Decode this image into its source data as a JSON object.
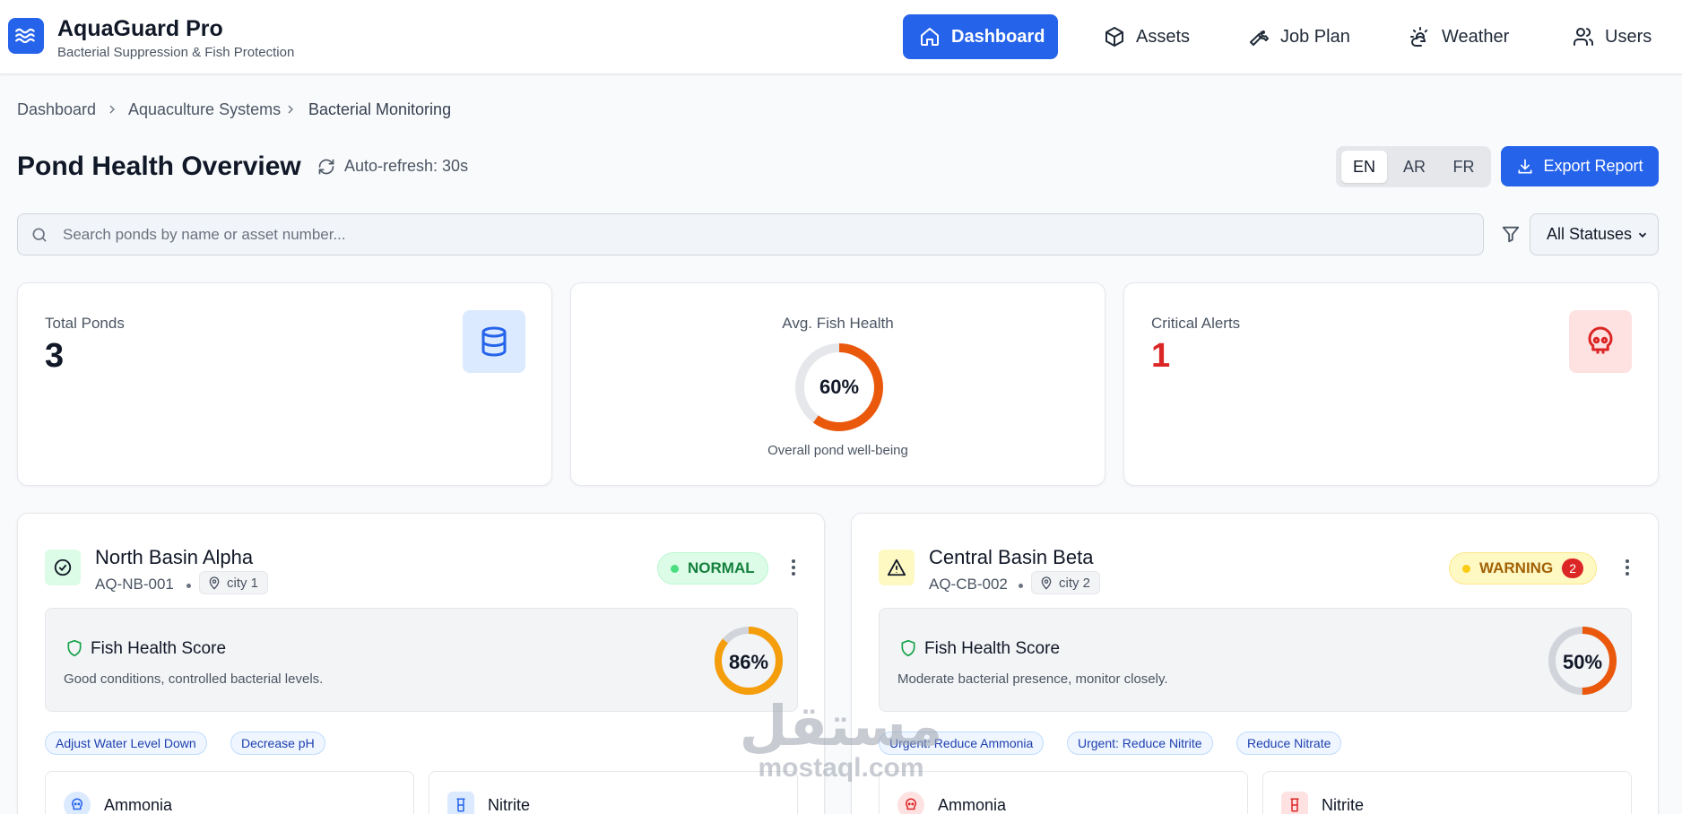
{
  "header": {
    "app_title": "AquaGuard Pro",
    "app_subtitle": "Bacterial Suppression & Fish Protection",
    "nav": [
      {
        "label": "Dashboard",
        "icon": "home-icon",
        "active": true
      },
      {
        "label": "Assets",
        "icon": "box-icon",
        "active": false
      },
      {
        "label": "Job Plan",
        "icon": "wrench-icon",
        "active": false
      },
      {
        "label": "Weather",
        "icon": "sun-cloud-icon",
        "active": false
      },
      {
        "label": "Users",
        "icon": "users-icon",
        "active": false
      }
    ]
  },
  "breadcrumb": [
    "Dashboard",
    "Aquaculture Systems",
    "Bacterial Monitoring"
  ],
  "page": {
    "title": "Pond Health Overview",
    "auto_refresh": "Auto-refresh: 30s",
    "languages": [
      "EN",
      "AR",
      "FR"
    ],
    "active_language": "EN",
    "export_label": "Export Report"
  },
  "search": {
    "placeholder": "Search ponds by name or asset number...",
    "value": "",
    "status_filter": "All Statuses"
  },
  "stats": {
    "total_ponds": {
      "label": "Total Ponds",
      "value": "3",
      "icon": "database-icon"
    },
    "avg_fish_health": {
      "label": "Avg. Fish Health",
      "value": "60%",
      "percent": 60,
      "caption": "Overall pond well-being"
    },
    "critical_alerts": {
      "label": "Critical Alerts",
      "value": "1",
      "icon": "skull-icon"
    }
  },
  "ponds": [
    {
      "name": "North Basin Alpha",
      "asset_id": "AQ-NB-001",
      "city": "city 1",
      "status": "NORMAL",
      "alert_count": "",
      "health_title": "Fish Health Score",
      "health_score": "86%",
      "health_percent": 86,
      "health_desc": "Good conditions, controlled bacterial levels.",
      "tags": [
        "Adjust Water Level Down",
        "Decrease pH"
      ],
      "metrics": [
        {
          "label": "Ammonia"
        },
        {
          "label": "Nitrite"
        }
      ]
    },
    {
      "name": "Central Basin Beta",
      "asset_id": "AQ-CB-002",
      "city": "city 2",
      "status": "WARNING",
      "alert_count": "2",
      "health_title": "Fish Health Score",
      "health_score": "50%",
      "health_percent": 50,
      "health_desc": "Moderate bacterial presence, monitor closely.",
      "tags": [
        "Urgent: Reduce Ammonia",
        "Urgent: Reduce Nitrite",
        "Reduce Nitrate"
      ],
      "metrics": [
        {
          "label": "Ammonia"
        },
        {
          "label": "Nitrite"
        }
      ]
    }
  ],
  "colors": {
    "primary": "#2563eb",
    "normal": "#16a34a",
    "warning": "#ca8a04",
    "critical": "#dc2626",
    "gauge_orange": "#ea580c",
    "gauge_amber": "#f59e0b"
  },
  "watermark": {
    "arabic": "مستقل",
    "latin": "mostaql.com"
  }
}
